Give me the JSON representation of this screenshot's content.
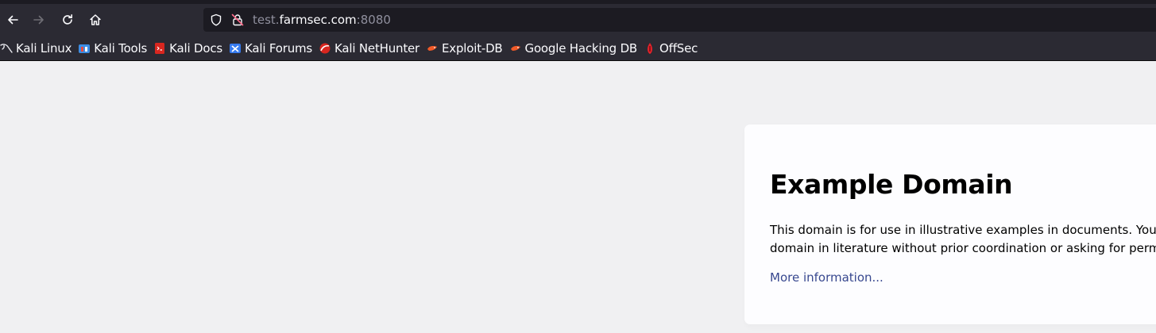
{
  "browser": {
    "url_scheme_prefix": "test.",
    "url_host": "farmsec.com",
    "url_port": ":8080",
    "nav_icons": [
      "back-arrow-icon",
      "forward-arrow-icon",
      "reload-icon",
      "home-icon"
    ],
    "url_icons": [
      "shield-icon",
      "insecure-lock-icon"
    ]
  },
  "bookmarks": [
    {
      "label": "Kali Linux",
      "icon": "kali-dragon-icon"
    },
    {
      "label": "Kali Tools",
      "icon": "kali-tools-icon"
    },
    {
      "label": "Kali Docs",
      "icon": "kali-docs-icon"
    },
    {
      "label": "Kali Forums",
      "icon": "kali-forums-icon"
    },
    {
      "label": "Kali NetHunter",
      "icon": "nethunter-icon"
    },
    {
      "label": "Exploit-DB",
      "icon": "exploit-db-icon"
    },
    {
      "label": "Google Hacking DB",
      "icon": "ghdb-icon"
    },
    {
      "label": "OffSec",
      "icon": "offsec-icon"
    }
  ],
  "page": {
    "heading": "Example Domain",
    "paragraph_line1": "This domain is for use in illustrative examples in documents. You may",
    "paragraph_line2": "domain in literature without prior coordination or asking for permissi",
    "link": "More information..."
  },
  "colors": {
    "toolbar": "#2b2a33",
    "urlbar": "#1c1b22",
    "page_bg": "#f0f0f2",
    "card_bg": "#fdfdff",
    "link": "#38488f"
  }
}
